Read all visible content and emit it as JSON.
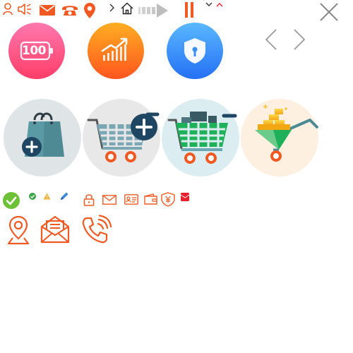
{
  "battery_badge": {
    "text": "100"
  },
  "colors": {
    "accent_orange": "#f05a22",
    "accent_red": "#e8202e",
    "pink_start": "#ff6fa7",
    "pink_end": "#ff3f6d",
    "orange_start": "#ffaa22",
    "orange_end": "#ff5a1e",
    "blue_start": "#58b2ff",
    "blue_end": "#2574f5",
    "cart_teal": "#6aa8b4",
    "cart_green": "#1fb05a",
    "wheel_orange": "#f05a22",
    "check_green": "#6cc136",
    "warning_yellow": "#f3b13a",
    "pencil_blue": "#3a86d6",
    "grey_icon": "#8a8a8a"
  },
  "icons": {
    "top_row": [
      "user-icon",
      "speaker-icon",
      "mail-icon",
      "phone-icon",
      "location-pin-icon",
      "chevron-right-icon",
      "home-icon",
      "progress-arrow-icon",
      "pause-icon",
      "chevron-down-icon",
      "chevron-up-icon",
      "close-icon"
    ],
    "round_badges": [
      "battery-100-icon",
      "growth-chart-icon",
      "shield-keyhole-icon"
    ],
    "nav_arrows": [
      "arrow-left-icon",
      "arrow-right-icon"
    ],
    "shopping_tiles": [
      "shopping-bag-add-icon",
      "cart-add-icon",
      "cart-full-icon",
      "gold-cart-icon"
    ],
    "small_row": [
      "check-circle-icon",
      "check-small-icon",
      "warning-icon",
      "pencil-icon",
      "lock-icon",
      "envelope-icon",
      "id-card-icon",
      "wallet-icon",
      "yen-shield-icon",
      "red-envelope-icon"
    ],
    "large_outline": [
      "location-outline-icon",
      "open-mail-icon",
      "phone-call-icon"
    ]
  }
}
